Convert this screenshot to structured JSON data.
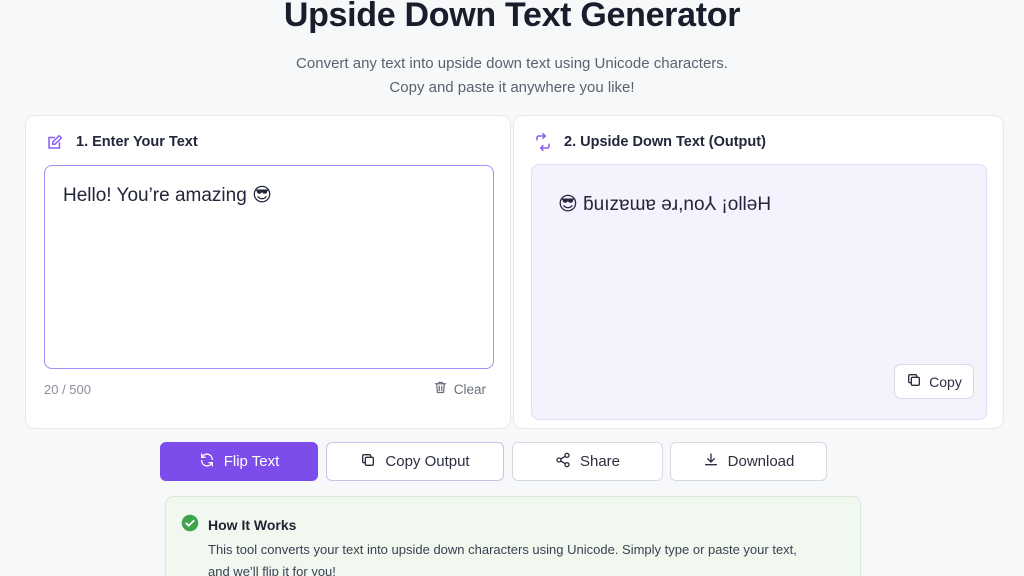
{
  "page": {
    "title": "Upside Down Text Generator",
    "subtitle_line1": "Convert any text into upside down text using Unicode characters.",
    "subtitle_line2": "Copy and paste it anywhere you like!"
  },
  "input_panel": {
    "heading": "1. Enter Your Text",
    "icon": "edit-icon",
    "value": "Hello! You’re amazing 😎",
    "counter": "20 / 500",
    "clear_label": "Clear"
  },
  "output_panel": {
    "heading": "2. Upside Down Text (Output)",
    "icon": "flip-arrows-icon",
    "value": "😎 ƃuızɐɯɐ ǝɹ,no⅄ ¡ollǝH",
    "copy_label": "Copy"
  },
  "actions": {
    "flip_label": "Flip Text",
    "copy_output_label": "Copy Output",
    "share_label": "Share",
    "download_label": "Download"
  },
  "how_it_works": {
    "heading": "How It Works",
    "body_line1": "This tool converts your text into upside down characters using Unicode. Simply type or paste your text,",
    "body_line2": "and we’ll flip it for you!"
  },
  "colors": {
    "accent": "#7c4dea",
    "output_bg": "#f5f1fd",
    "info_bg": "#f1f8f0",
    "success": "#3fa34d"
  }
}
